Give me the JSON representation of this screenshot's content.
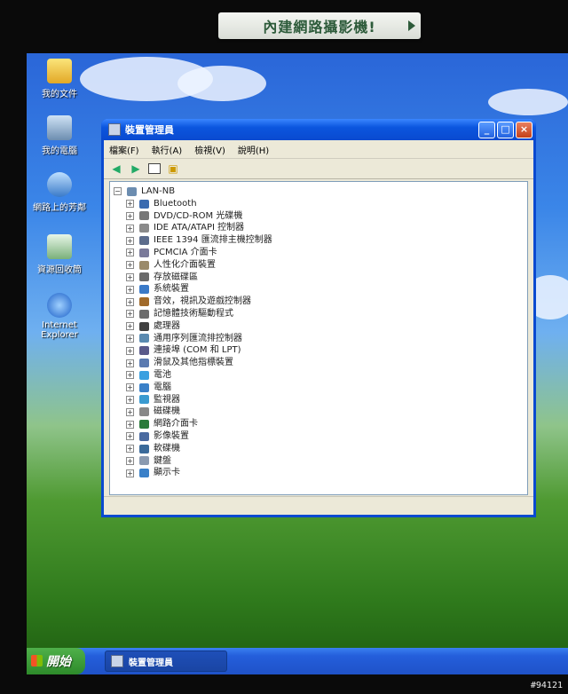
{
  "sticker": {
    "text": "內建網路攝影機!"
  },
  "desktop": {
    "icons": [
      {
        "label": "我的文件",
        "icon": "documents-folder-icon"
      },
      {
        "label": "我的電腦",
        "icon": "computer-icon"
      },
      {
        "label": "網路上的芳鄰",
        "icon": "network-places-icon"
      },
      {
        "label": "資源回收筒",
        "icon": "recycle-bin-icon"
      },
      {
        "label": "Internet Explorer",
        "icon": "internet-explorer-icon"
      }
    ]
  },
  "window": {
    "title": "裝置管理員",
    "menu": [
      "檔案(F)",
      "執行(A)",
      "檢視(V)",
      "說明(H)"
    ],
    "toolbar": [
      "back-arrow-icon",
      "forward-arrow-icon",
      "properties-icon",
      "help-icon"
    ],
    "tree": {
      "root": "LAN-NB",
      "children": [
        "Bluetooth",
        "DVD/CD-ROM 光碟機",
        "IDE ATA/ATAPI 控制器",
        "IEEE 1394 匯流排主機控制器",
        "PCMCIA 介面卡",
        "人性化介面裝置",
        "存放磁碟區",
        "系統裝置",
        "音效，視訊及遊戲控制器",
        "記憶體技術驅動程式",
        "處理器",
        "通用序列匯流排控制器",
        "連接埠 (COM 和 LPT)",
        "滑鼠及其他指標裝置",
        "電池",
        "電腦",
        "監視器",
        "磁碟機",
        "網路介面卡",
        "影像裝置",
        "軟碟機",
        "鍵盤",
        "顯示卡"
      ]
    }
  },
  "taskbar": {
    "start_label": "開始",
    "task_label": "裝置管理員"
  },
  "watermark": "#94121",
  "colors": {
    "title_blue": "#0a4ad0",
    "taskbar_blue": "#245edb",
    "start_green": "#2d8a2a"
  }
}
